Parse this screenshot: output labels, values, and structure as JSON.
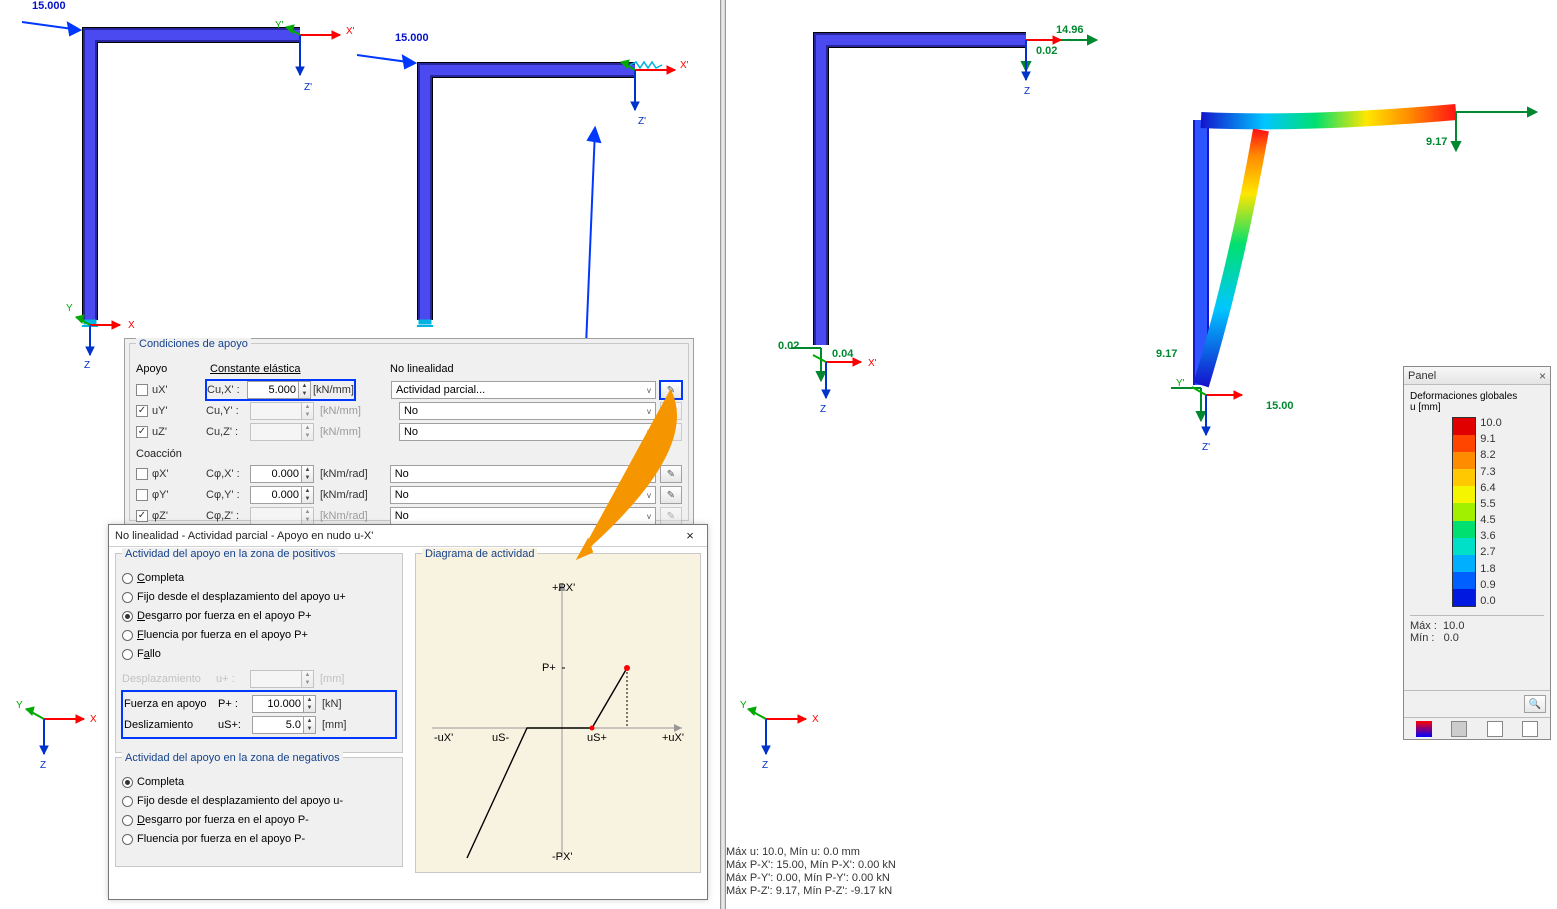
{
  "left": {
    "load1": "15.000",
    "load2": "15.000"
  },
  "cond_dlg": {
    "title": "Condiciones de apoyo",
    "col_apoyo": "Apoyo",
    "col_const": "Constante elástica",
    "col_nolin": "No linealidad",
    "rows": {
      "ux": {
        "label": "uX'",
        "checked": false,
        "c_label": "Cu,X' :",
        "value": "5.000",
        "unit": "[kN/mm]",
        "unit_enabled": true,
        "nl": "Actividad parcial...",
        "nl_enabled": true
      },
      "uy": {
        "label": "uY'",
        "checked": true,
        "c_label": "Cu,Y' :",
        "value": "",
        "unit": "[kN/mm]",
        "unit_enabled": false,
        "nl": "No",
        "nl_enabled": false
      },
      "uz": {
        "label": "uZ'",
        "checked": true,
        "c_label": "Cu,Z' :",
        "value": "",
        "unit": "[kN/mm]",
        "unit_enabled": false,
        "nl": "No",
        "nl_enabled": false
      }
    },
    "coaccion": "Coacción",
    "crows": {
      "phx": {
        "label": "φX'",
        "checked": false,
        "c_label": "Cφ,X' :",
        "value": "0.000",
        "unit": "[kNm/rad]",
        "unit_enabled": true,
        "nl": "No",
        "nl_enabled": true
      },
      "phy": {
        "label": "φY'",
        "checked": false,
        "c_label": "Cφ,Y' :",
        "value": "0.000",
        "unit": "[kNm/rad]",
        "unit_enabled": true,
        "nl": "No",
        "nl_enabled": true
      },
      "phz": {
        "label": "φZ'",
        "checked": true,
        "c_label": "Cφ,Z' :",
        "value": "",
        "unit": "[kNm/rad]",
        "unit_enabled": false,
        "nl": "No",
        "nl_enabled": false
      }
    }
  },
  "sub_dlg": {
    "title": "No linealidad - Actividad parcial - Apoyo en nudo u-X'",
    "grp_pos": "Actividad del apoyo en la zona de positivos",
    "opts_pos": {
      "completa": "Completa",
      "fijo": "Fijo desde el desplazamiento del apoyo u+",
      "desgarro": "Desgarro por fuerza en el apoyo P+",
      "fluencia": "Fluencia por fuerza en el apoyo P+",
      "fallo": "Fallo"
    },
    "despl": {
      "label": "Desplazamiento",
      "sym": "u+ :",
      "value": "",
      "unit": "[mm]"
    },
    "fuerza": {
      "label": "Fuerza en apoyo",
      "sym": "P+ :",
      "value": "10.000",
      "unit": "[kN]"
    },
    "desliz": {
      "label": "Deslizamiento",
      "sym": "uS+:",
      "value": "5.0",
      "unit": "[mm]"
    },
    "grp_neg": "Actividad del apoyo en la zona de negativos",
    "opts_neg": {
      "completa": "Completa",
      "fijo": "Fijo desde el desplazamiento del apoyo u-",
      "desgarro": "Desgarro por fuerza en el apoyo P-",
      "fluencia": "Fluencia por fuerza en el apoyo P-"
    },
    "diagram": {
      "title": "Diagrama de actividad",
      "labels": {
        "py": "+PX'",
        "ny": "-PX'",
        "px": "+uX'",
        "nx": "-uX'",
        "pp": "P+",
        "usm": "uS-",
        "usp": "uS+"
      }
    }
  },
  "right": {
    "res": {
      "a": "0.02",
      "b": "14.96",
      "c": "0.02",
      "d": "0.04",
      "e": "9.17",
      "f": "9.17",
      "g": "15.00"
    }
  },
  "panel": {
    "title": "Panel",
    "head1": "Deformaciones globales",
    "head2": "u [mm]",
    "ticks": [
      "10.0",
      "9.1",
      "8.2",
      "7.3",
      "6.4",
      "5.5",
      "4.5",
      "3.6",
      "2.7",
      "1.8",
      "0.9",
      "0.0"
    ],
    "max_lbl": "Máx :",
    "max": "10.0",
    "min_lbl": "Mín :",
    "min": "0.0"
  },
  "stats": {
    "l1": "Máx u: 10.0, Mín u: 0.0 mm",
    "l2": "Máx P-X': 15.00, Mín P-X': 0.00 kN",
    "l3": "Máx P-Y': 0.00, Mín P-Y': 0.00 kN",
    "l4": "Máx P-Z': 9.17, Mín P-Z': -9.17 kN"
  },
  "axis": {
    "x": "X",
    "y": "Y",
    "z": "Z",
    "xp": "X'",
    "yp": "Y'",
    "zp": "Z'"
  }
}
